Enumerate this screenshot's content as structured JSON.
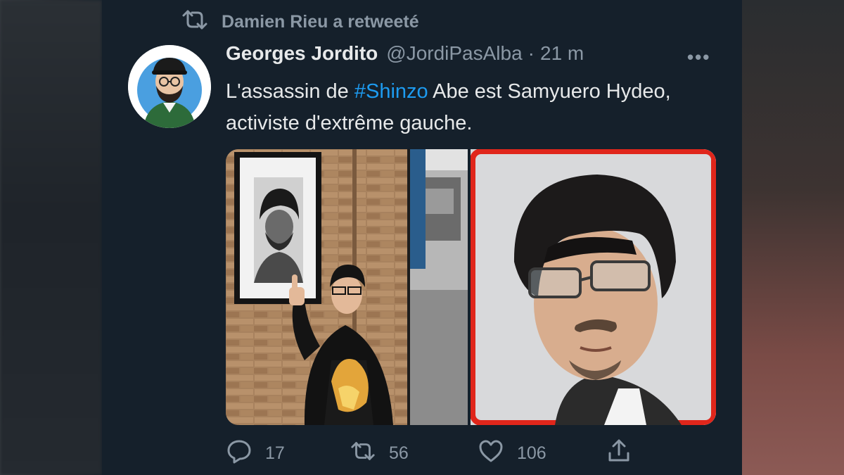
{
  "retweet_banner": {
    "text": "Damien Rieu a retweeté",
    "icon": "retweet-icon"
  },
  "tweet": {
    "author_name": "Georges Jordito",
    "handle": "@JordiPasAlba",
    "separator": "·",
    "time": "21 m",
    "more": "•••",
    "text_before": "L'assassin de ",
    "hashtag": "#Shinzo",
    "text_after": " Abe est Samyuero Hydeo, activiste d'extrême gauche.",
    "media": [
      {
        "description_icon": "photo-man-under-portrait"
      },
      {
        "description_icon": "photo-man-with-glasses",
        "border_color": "#e0261b"
      }
    ]
  },
  "actions": {
    "reply_count": "17",
    "retweet_count": "56",
    "like_count": "106"
  },
  "colors": {
    "background": "#15202b",
    "text": "#e7e9ea",
    "muted": "#8b98a5",
    "hashtag": "#1d9bf0",
    "highlight_border": "#e0261b"
  }
}
